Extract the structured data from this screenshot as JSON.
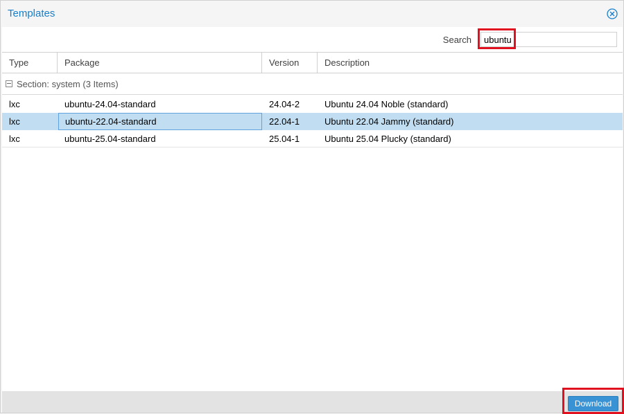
{
  "window": {
    "title": "Templates",
    "close_icon": "close-circle-icon"
  },
  "toolbar": {
    "search_label": "Search",
    "search_value": "ubuntu"
  },
  "grid": {
    "columns": [
      "Type",
      "Package",
      "Version",
      "Description"
    ],
    "group": {
      "label": "Section: system (3 Items)",
      "toggle_icon": "collapse-minus-icon"
    },
    "rows": [
      {
        "type": "lxc",
        "package": "ubuntu-24.04-standard",
        "version": "24.04-2",
        "description": "Ubuntu 24.04 Noble (standard)",
        "selected": false
      },
      {
        "type": "lxc",
        "package": "ubuntu-22.04-standard",
        "version": "22.04-1",
        "description": "Ubuntu 22.04 Jammy (standard)",
        "selected": true
      },
      {
        "type": "lxc",
        "package": "ubuntu-25.04-standard",
        "version": "25.04-1",
        "description": "Ubuntu 25.04 Plucky (standard)",
        "selected": false
      }
    ]
  },
  "footer": {
    "download_label": "Download"
  },
  "colors": {
    "title": "#157fcc",
    "selected_row": "#c1ddf1",
    "button": "#3892d4",
    "highlight": "#e0101e"
  }
}
